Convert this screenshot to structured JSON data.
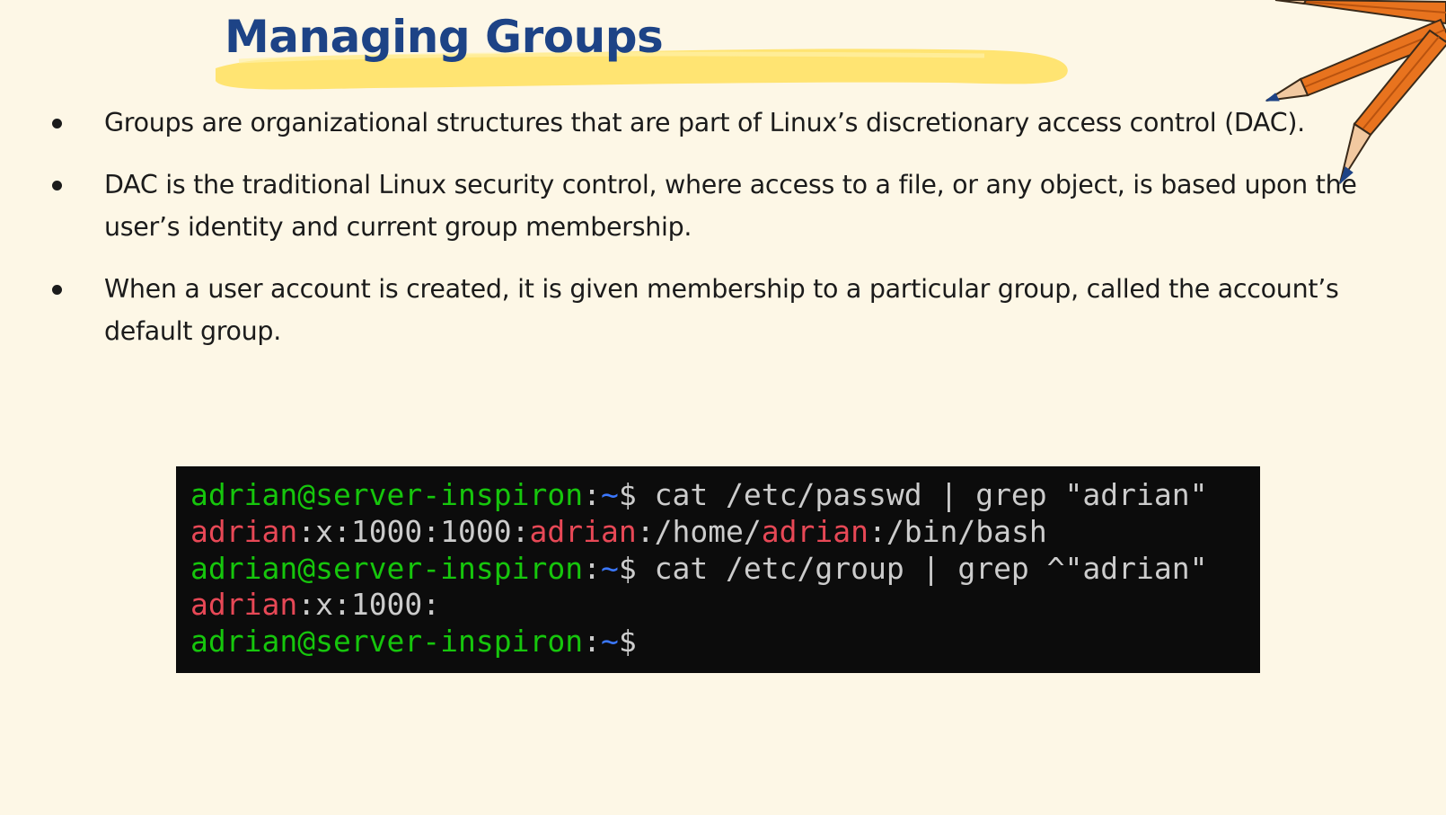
{
  "slide": {
    "title": "Managing Groups",
    "bullets": [
      "Groups are organizational structures that are part of Linux’s discretionary access control (DAC).",
      "DAC is the traditional Linux security control, where access to a file, or any object, is based upon the user’s identity and current group membership.",
      "When a user account is created, it is given membership to a particular group, called the account’s default group."
    ]
  },
  "terminal": {
    "lines": [
      [
        {
          "text": "adrian@server-inspiron",
          "color": "green"
        },
        {
          "text": ":",
          "color": "white"
        },
        {
          "text": "~",
          "color": "blue"
        },
        {
          "text": "$ cat /etc/passwd | grep \"adrian\"",
          "color": "white"
        }
      ],
      [
        {
          "text": "adrian",
          "color": "red"
        },
        {
          "text": ":x:1000:1000:",
          "color": "white"
        },
        {
          "text": "adrian",
          "color": "red"
        },
        {
          "text": ":/home/",
          "color": "white"
        },
        {
          "text": "adrian",
          "color": "red"
        },
        {
          "text": ":/bin/bash",
          "color": "white"
        }
      ],
      [
        {
          "text": "adrian@server-inspiron",
          "color": "green"
        },
        {
          "text": ":",
          "color": "white"
        },
        {
          "text": "~",
          "color": "blue"
        },
        {
          "text": "$ cat /etc/group | grep ^\"adrian\"",
          "color": "white"
        }
      ],
      [
        {
          "text": "adrian",
          "color": "red"
        },
        {
          "text": ":x:1000:",
          "color": "white"
        }
      ],
      [
        {
          "text": "adrian@server-inspiron",
          "color": "green"
        },
        {
          "text": ":",
          "color": "white"
        },
        {
          "text": "~",
          "color": "blue"
        },
        {
          "text": "$",
          "color": "white"
        }
      ]
    ]
  },
  "colors": {
    "background": "#fdf7e6",
    "title": "#1d4386",
    "highlight": "#ffe36b",
    "terminal_bg": "#0c0c0c",
    "prompt_green": "#16c60c",
    "path_blue": "#3b78ff",
    "match_red": "#e74856",
    "pencil_orange": "#e8731e"
  },
  "icons": {
    "decoration": "pencils-icon"
  }
}
